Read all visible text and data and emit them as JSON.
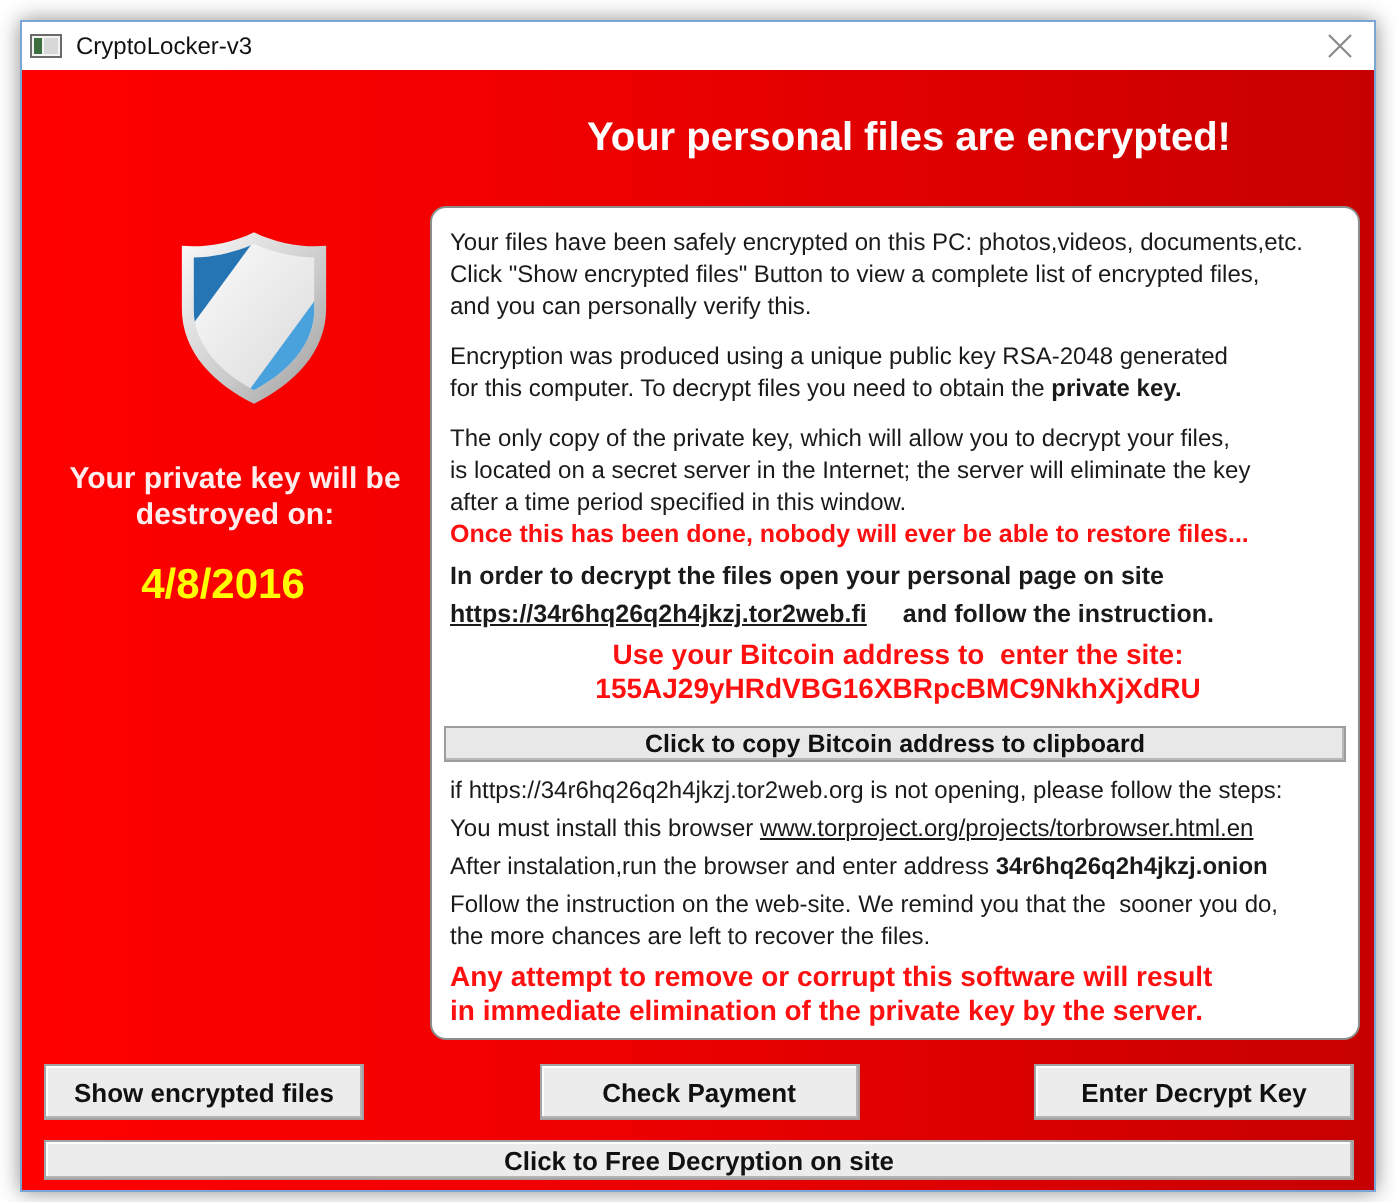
{
  "window": {
    "title": "CryptoLocker-v3"
  },
  "heading": "Your personal files are encrypted!",
  "sidebar": {
    "warning": "Your private key will be destroyed on:",
    "date": "4/8/2016"
  },
  "message_panel": {
    "blocks": [
      {
        "kind": "paragraph",
        "text": "Your files have been safely encrypted on this PC: photos,videos, documents,etc.\nClick \"Show encrypted files\" Button to view a complete list of encrypted files,\nand you can personally verify this."
      },
      {
        "kind": "paragraph",
        "text": "Encryption was produced using a unique public key RSA-2048 generated\nfor this computer. To decrypt files you need to obtain the **private key.**"
      },
      {
        "kind": "paragraph",
        "text": "The only copy of the private key, which will allow you to decrypt your files,\nis located on a secret server in the Internet; the server will eliminate the key\nafter a time period specified in this window."
      },
      {
        "kind": "alert",
        "text": "Once this has been done, nobody will ever be able to restore files..."
      },
      {
        "kind": "emphasis",
        "text": "In order to decrypt the files open your personal page on site"
      },
      {
        "kind": "site_link",
        "link": "https://34r6hq26q2h4jkzj.tor2web.fi",
        "text": "and follow the instruction."
      },
      {
        "kind": "bitcoin",
        "text": "Use your Bitcoin address to  enter the site:",
        "address": "155AJ29yHRdVBG16XBRpcBMC9NkhXjXdRU"
      },
      {
        "kind": "button",
        "label": "Click to copy Bitcoin address to clipboard"
      },
      {
        "kind": "step",
        "text": "if https://34r6hq26q2h4jkzj.tor2web.org is not opening, please follow the steps:"
      },
      {
        "kind": "browser_link",
        "text": "You must install this browser",
        "link": "www.torproject.org/projects/torbrowser.html.en"
      },
      {
        "kind": "step",
        "text": "After instalation,run the browser and enter address **34r6hq26q2h4jkzj.onion**"
      },
      {
        "kind": "step",
        "text": "Follow the instruction on the web-site. We remind you that the  sooner you do,\nthe more chances are left to recover the files."
      },
      {
        "kind": "big_alert",
        "text": "Any attempt to remove or corrupt this software will result\nin immediate elimination of the private key by the server."
      }
    ]
  },
  "buttons": [
    {
      "label": "Show encrypted files"
    },
    {
      "label": "Check Payment"
    },
    {
      "label": "Enter Decrypt Key"
    }
  ],
  "bottom_button": {
    "label": "Click to Free Decryption on site"
  }
}
